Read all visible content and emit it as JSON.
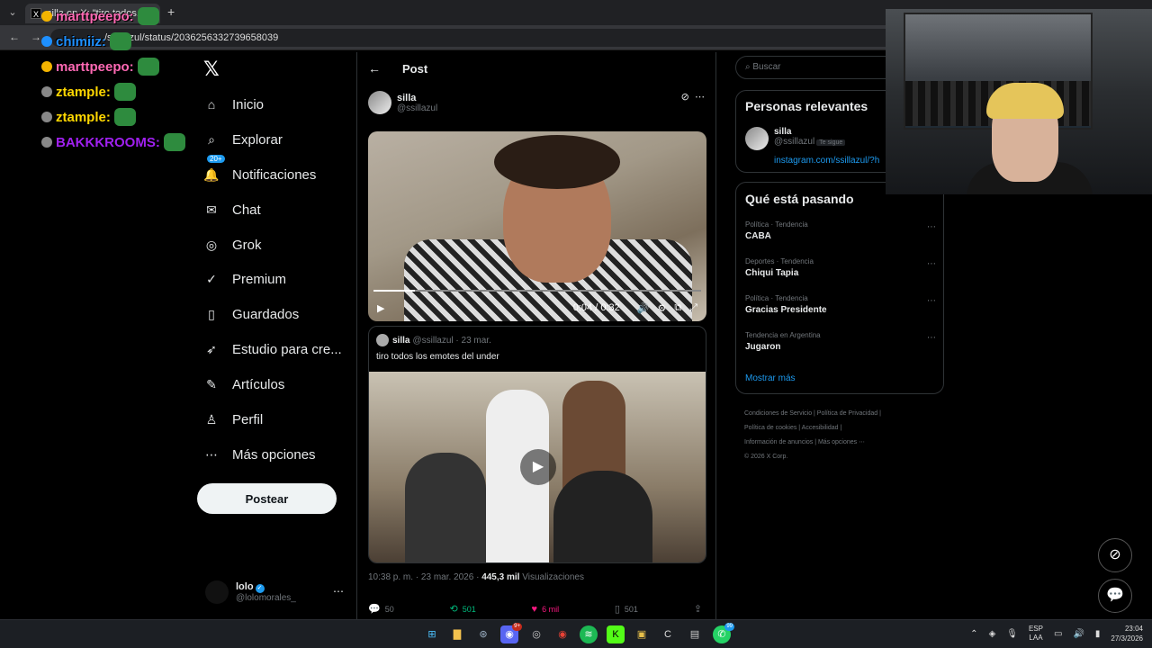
{
  "browser": {
    "tab_title": "silla en X: \"tiro todos...\"",
    "tab_favicon": "X",
    "new_tab": "+",
    "url": "/ssillazul/status/2036256332739658039"
  },
  "chat_overlay": [
    {
      "user": "chimiiz:",
      "color": "#1e90ff"
    },
    {
      "user": "marttpeepo:",
      "color": "#ff69b4"
    },
    {
      "user": "ztample:",
      "color": "#ffd700"
    },
    {
      "user": "ztample:",
      "color": "#ffd700"
    },
    {
      "user": "BAKKKROOMS:",
      "color": "#a020f0"
    }
  ],
  "nav": {
    "logo": "𝕏",
    "items": [
      {
        "label": "Inicio",
        "icon": "⌂"
      },
      {
        "label": "Explorar",
        "icon": "⌕"
      },
      {
        "label": "Notificaciones",
        "icon": "🔔",
        "badge": "20+"
      },
      {
        "label": "Chat",
        "icon": "✉"
      },
      {
        "label": "Grok",
        "icon": "◎"
      },
      {
        "label": "Premium",
        "icon": "✓"
      },
      {
        "label": "Guardados",
        "icon": "▯"
      },
      {
        "label": "Estudio para cre...",
        "icon": "➶"
      },
      {
        "label": "Artículos",
        "icon": "✎"
      },
      {
        "label": "Perfil",
        "icon": "♙"
      },
      {
        "label": "Más opciones",
        "icon": "⋯"
      }
    ],
    "post_button": "Postear",
    "account": {
      "name": "lolo",
      "handle": "@lolomorales_",
      "more": "⋯"
    }
  },
  "post": {
    "header_title": "Post",
    "author_name": "silla",
    "author_handle": "@ssillazul",
    "video": {
      "current": "0:04",
      "duration": "0:32",
      "progress": 0.125
    },
    "quote": {
      "name": "silla",
      "handle": "@ssillazul · 23 mar.",
      "text": "tiro todos los emotes del under"
    },
    "timestamp": "10:38 p. m. · 23 mar. 2026 · ",
    "views_count": "445,3 mil",
    "views_label": " Visualizaciones",
    "replies": "50",
    "reposts": "501",
    "likes": "6 mil",
    "bookmarks": "501"
  },
  "sidebar": {
    "search_placeholder": "Buscar",
    "relevant_title": "Personas relevantes",
    "relevant_user": {
      "name": "silla",
      "handle": "@ssillazul",
      "follows_you": "Te sigue",
      "link": "instagram.com/ssillazul/?h"
    },
    "trends_title": "Qué está pasando",
    "trends": [
      {
        "category": "Política · Tendencia",
        "name": "CABA"
      },
      {
        "category": "Deportes · Tendencia",
        "name": "Chiqui Tapia"
      },
      {
        "category": "Política · Tendencia",
        "name": "Gracias Presidente"
      },
      {
        "category": "Tendencia en Argentina",
        "name": "Jugaron"
      }
    ],
    "show_more": "Mostrar más",
    "footer": {
      "l1": "Condiciones de Servicio  |   Política de Privacidad  |",
      "l2": "Política de cookies  |   Accesibilidad  |",
      "l3": "Información de anuncios  |   Más opciones ⋯",
      "l4": "© 2026 X Corp."
    }
  },
  "taskbar": {
    "lang_top": "ESP",
    "lang_bottom": "LAA",
    "time": "23:04",
    "date": "27/3/2026",
    "discord_badge": "9+",
    "whatsapp_badge": "99"
  }
}
